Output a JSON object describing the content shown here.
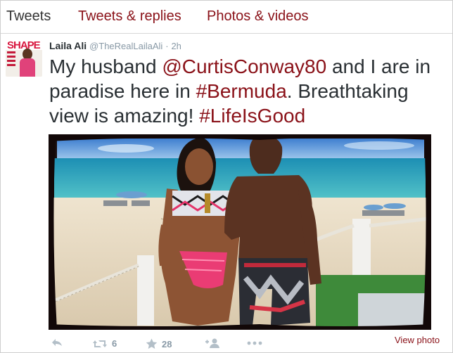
{
  "tabs": [
    {
      "label": "Tweets"
    },
    {
      "label": "Tweets & replies"
    },
    {
      "label": "Photos & videos"
    }
  ],
  "tweet": {
    "author_name": "Laila Ali",
    "handle": "@TheRealLailaAli",
    "separator": "·",
    "time": "2h",
    "text_parts": {
      "p1": "My husband ",
      "mention": "@CurtisConway80",
      "p2": " and I are in paradise here in ",
      "tag1": "#Bermuda",
      "p3": ". Breathtaking view is amazing! ",
      "tag2": "#LifeIsGood"
    },
    "avatar_brand": "SHAPE",
    "view_photo": "View photo",
    "retweet_count": "6",
    "favorite_count": "28"
  },
  "colors": {
    "link": "#8a1118",
    "muted": "#8899a6",
    "text": "#292f33"
  },
  "icons": {
    "reply": "reply-icon",
    "retweet": "retweet-icon",
    "favorite": "star-icon",
    "follow": "add-user-icon",
    "more": "more-icon"
  }
}
